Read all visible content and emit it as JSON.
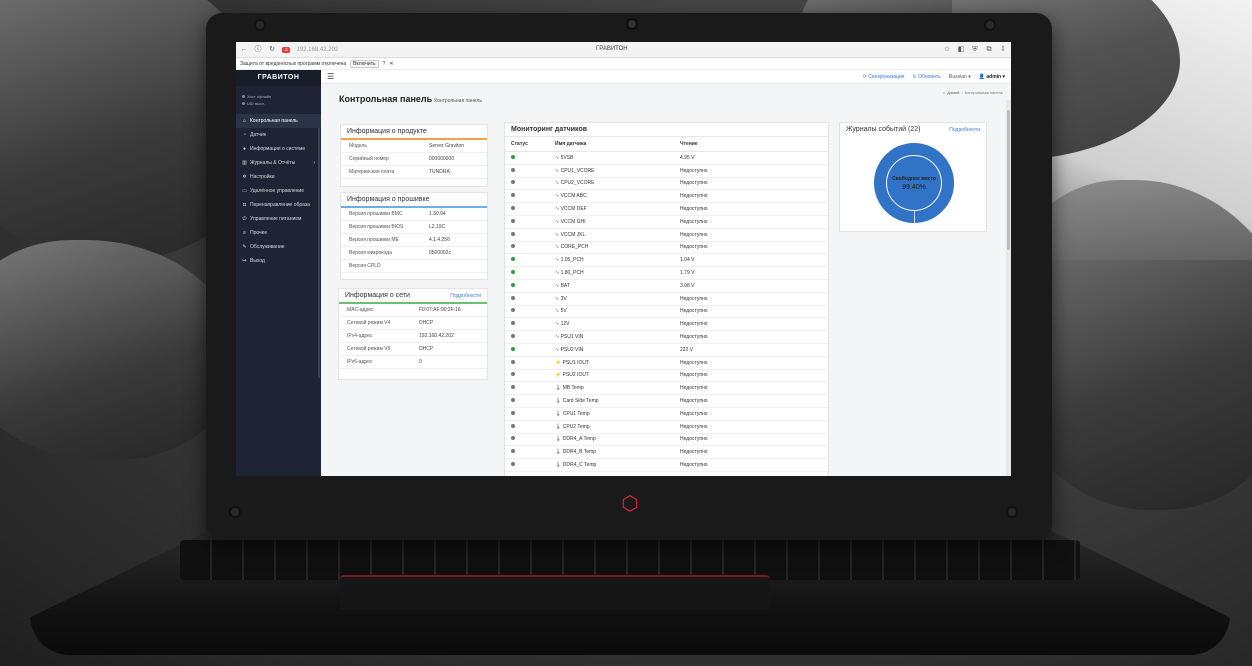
{
  "browser": {
    "url": "192.168.42.202",
    "title": "ГРАВИТОН",
    "protection_text": "Защита от вредоносных программ отключена",
    "enable_label": "Включить"
  },
  "sidebar": {
    "brand": "ГРАВИТОН",
    "status": [
      "Хост офлайн",
      "UID выкл."
    ],
    "items": [
      {
        "label": "Контрольная панель",
        "icon": "home-icon",
        "active": true
      },
      {
        "label": "Датчик",
        "icon": "gauge-icon"
      },
      {
        "label": "Информация о системе",
        "icon": "info-icon"
      },
      {
        "label": "Журналы & Отчёты",
        "icon": "chart-icon"
      },
      {
        "label": "Настройки",
        "icon": "gear-icon"
      },
      {
        "label": "Удалённое управление",
        "icon": "monitor-icon"
      },
      {
        "label": "Перенаправление образа",
        "icon": "disk-icon"
      },
      {
        "label": "Управление питанием",
        "icon": "power-icon"
      },
      {
        "label": "Прочее",
        "icon": "list-icon"
      },
      {
        "label": "Обслуживание",
        "icon": "wrench-icon"
      },
      {
        "label": "Выход",
        "icon": "logout-icon"
      }
    ]
  },
  "topbar": {
    "sync": "Синхронизация",
    "refresh": "Обновить",
    "language": "Russian",
    "user": "admin"
  },
  "breadcrumb": {
    "home": "Домой",
    "current": "Контрольная панель"
  },
  "page": {
    "title": "Контрольная панель",
    "subtitle": "Контрольная панель"
  },
  "product": {
    "header": "Информация о продукте",
    "rows": [
      {
        "k": "Модель",
        "v": "Server Graviton"
      },
      {
        "k": "Серийный номер",
        "v": "000000000"
      },
      {
        "k": "Материнская плата",
        "v": "TUNDRA"
      }
    ]
  },
  "firmware": {
    "header": "Информация о прошивке",
    "rows": [
      {
        "k": "Версия прошивки BMC",
        "v": "1.30.04"
      },
      {
        "k": "Версия прошивки BIOS",
        "v": "L2.19C"
      },
      {
        "k": "Версия прошивки ME",
        "v": "4.1.4.256"
      },
      {
        "k": "Версия микрокода",
        "v": "0500002c"
      },
      {
        "k": "Версия CPLD",
        "v": ""
      }
    ]
  },
  "network": {
    "header": "Информация о сети",
    "more": "Подробности",
    "rows": [
      {
        "k": "MAC-адрес",
        "v": "F0:07:AF:90:2F:16"
      },
      {
        "k": "Сетевой режим V4",
        "v": "DHCP"
      },
      {
        "k": "IPv4-адрес",
        "v": "192.168.42.202"
      },
      {
        "k": "Сетевой режим V6",
        "v": "DHCP"
      },
      {
        "k": "IPv6-адрес",
        "v": "0"
      }
    ]
  },
  "sensors": {
    "header": "Мониторинг датчиков",
    "cols": [
      "Статус",
      "Имя датчика",
      "Чтение"
    ],
    "colors": {
      "ok": "#2e9e44",
      "na": "#777777"
    },
    "rows": [
      {
        "status": "ok",
        "name": "5VSB",
        "reading": "4.95 V",
        "icon": "voltage-icon"
      },
      {
        "status": "na",
        "name": "CPU1_VCORE",
        "reading": "Недоступно",
        "icon": "voltage-icon"
      },
      {
        "status": "na",
        "name": "CPU2_VCORE",
        "reading": "Недоступно",
        "icon": "voltage-icon"
      },
      {
        "status": "na",
        "name": "VCCM ABC",
        "reading": "Недоступно",
        "icon": "voltage-icon"
      },
      {
        "status": "na",
        "name": "VCCM DEF",
        "reading": "Недоступно",
        "icon": "voltage-icon"
      },
      {
        "status": "na",
        "name": "VCCM GHI",
        "reading": "Недоступно",
        "icon": "voltage-icon"
      },
      {
        "status": "na",
        "name": "VCCM JKL",
        "reading": "Недоступно",
        "icon": "voltage-icon"
      },
      {
        "status": "na",
        "name": "CORE_PCH",
        "reading": "Недоступно",
        "icon": "voltage-icon"
      },
      {
        "status": "ok",
        "name": "1.05_PCH",
        "reading": "1.04 V",
        "icon": "voltage-icon"
      },
      {
        "status": "ok",
        "name": "1.80_PCH",
        "reading": "1.79 V",
        "icon": "voltage-icon"
      },
      {
        "status": "ok",
        "name": "BAT",
        "reading": "3.08 V",
        "icon": "voltage-icon"
      },
      {
        "status": "na",
        "name": "3V",
        "reading": "Недоступно",
        "icon": "voltage-icon"
      },
      {
        "status": "na",
        "name": "5V",
        "reading": "Недоступно",
        "icon": "voltage-icon"
      },
      {
        "status": "na",
        "name": "12V",
        "reading": "Недоступно",
        "icon": "voltage-icon"
      },
      {
        "status": "na",
        "name": "PSU1 VIN",
        "reading": "Недоступно",
        "icon": "voltage-icon"
      },
      {
        "status": "ok",
        "name": "PSU2 VIN",
        "reading": "222 V",
        "icon": "voltage-icon"
      },
      {
        "status": "na",
        "name": "PSU1 IOUT",
        "reading": "Недоступно",
        "icon": "current-icon"
      },
      {
        "status": "na",
        "name": "PSU2 IOUT",
        "reading": "Недоступно",
        "icon": "current-icon"
      },
      {
        "status": "na",
        "name": "MB Temp",
        "reading": "Недоступно",
        "icon": "thermometer-icon"
      },
      {
        "status": "na",
        "name": "Card Side Temp",
        "reading": "Недоступно",
        "icon": "thermometer-icon"
      },
      {
        "status": "na",
        "name": "CPU1 Temp",
        "reading": "Недоступно",
        "icon": "thermometer-icon"
      },
      {
        "status": "na",
        "name": "CPU2 Temp",
        "reading": "Недоступно",
        "icon": "thermometer-icon"
      },
      {
        "status": "na",
        "name": "DDR4_A Temp",
        "reading": "Недоступно",
        "icon": "thermometer-icon"
      },
      {
        "status": "na",
        "name": "DDR4_B Temp",
        "reading": "Недоступно",
        "icon": "thermometer-icon"
      },
      {
        "status": "na",
        "name": "DDR4_C Temp",
        "reading": "Недоступно",
        "icon": "thermometer-icon"
      }
    ]
  },
  "events": {
    "header": "Журналы событий (22)",
    "more": "Подробности",
    "label": "Свободное место",
    "value": "99.40%",
    "free_fraction": 0.994,
    "ring_color": "#3173c6"
  }
}
